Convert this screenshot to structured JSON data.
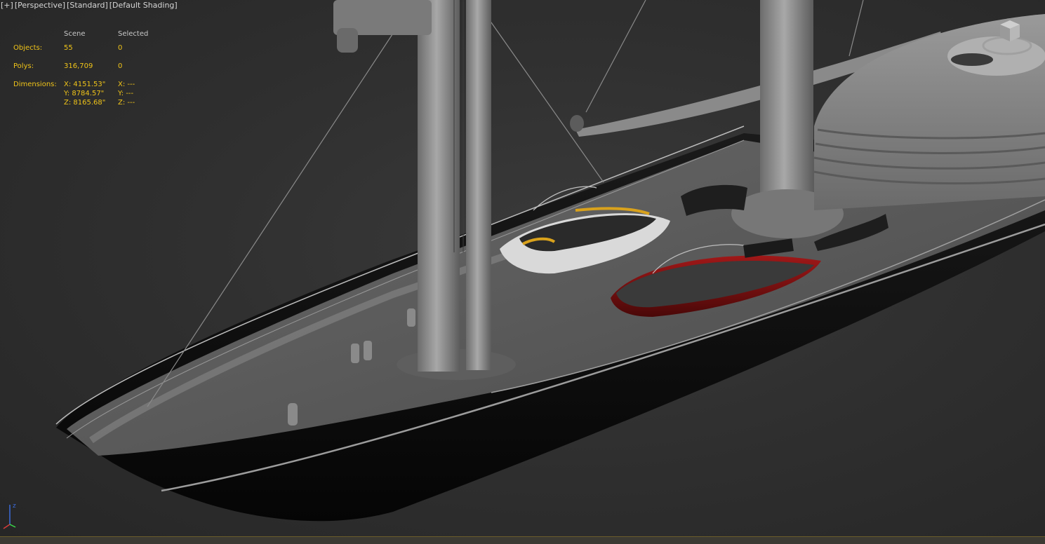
{
  "viewport": {
    "menus": [
      {
        "label": "[+]"
      },
      {
        "label": "[Perspective]"
      },
      {
        "label": "[Standard]"
      },
      {
        "label": "[Default Shading]"
      }
    ]
  },
  "stats": {
    "header": {
      "scene": "Scene",
      "selected": "Selected"
    },
    "objects": {
      "label": "Objects:",
      "scene": "55",
      "selected": "0"
    },
    "polys": {
      "label": "Polys:",
      "scene": "316,709",
      "selected": "0"
    },
    "dimensions": {
      "label": "Dimensions:",
      "scene_x": "X: 4151.53\"",
      "scene_y": "Y: 8784.57\"",
      "scene_z": "Z: 8165.68\"",
      "selected_x": "X: ---",
      "selected_y": "Y: ---",
      "selected_z": "Z: ---"
    }
  },
  "colors": {
    "stats_text": "#f0c419",
    "hull": "#0d0d0d",
    "deck": "#5a5a5a",
    "mast": "#8c8c8c",
    "tender_red": "#8b1414",
    "tender_yellow": "#d9a21c"
  },
  "icons": {
    "viewcube": "viewcube-icon",
    "axis": "axis-tripod-icon"
  }
}
